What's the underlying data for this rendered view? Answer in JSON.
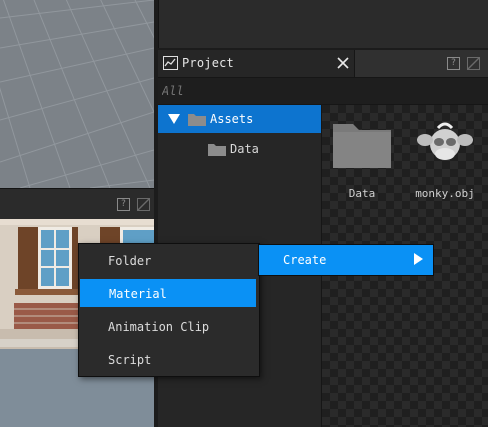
{
  "project_panel": {
    "title": "Project",
    "search_placeholder": "All",
    "tree": [
      {
        "label": "Assets",
        "selected": true
      },
      {
        "label": "Data",
        "selected": false
      }
    ],
    "assets": [
      {
        "label": "Data",
        "icon": "folder-icon"
      },
      {
        "label": "monky.obj",
        "icon": "monkey-mesh-icon"
      }
    ]
  },
  "context_menu": {
    "items": [
      {
        "label": "Folder",
        "highlighted": false
      },
      {
        "label": "Material",
        "highlighted": true
      },
      {
        "label": "Animation Clip",
        "highlighted": false
      },
      {
        "label": "Script",
        "highlighted": false
      }
    ],
    "parent_item": {
      "label": "Create"
    }
  },
  "panel_icons": {
    "help": "?"
  },
  "colors": {
    "selection": "#0d74cf",
    "menu_highlight": "#0a91f5"
  }
}
